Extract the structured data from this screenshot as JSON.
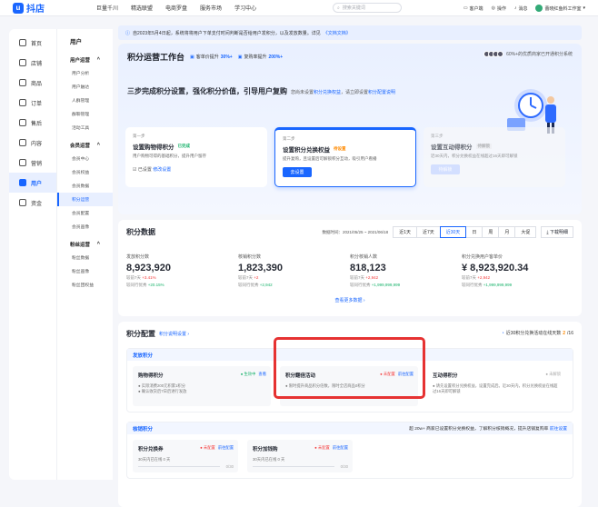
{
  "brand": {
    "name": "抖店"
  },
  "topnav": [
    "巨量千川",
    "精选联盟",
    "电商罗盘",
    "服务市场",
    "学习中心"
  ],
  "search": {
    "placeholder": "搜索关键词"
  },
  "topright": {
    "service": "客户端",
    "help": "操作",
    "msg": "消息",
    "shop": "蕾晓红鱼料工作室"
  },
  "sidebar1": [
    {
      "label": "首页"
    },
    {
      "label": "店铺"
    },
    {
      "label": "商品"
    },
    {
      "label": "订单"
    },
    {
      "label": "售后"
    },
    {
      "label": "内容"
    },
    {
      "label": "营销"
    },
    {
      "label": "用户",
      "active": true
    },
    {
      "label": "资金"
    }
  ],
  "sidebar2": {
    "title": "用户",
    "groups": [
      {
        "label": "用户运营",
        "items": [
          "用户分析",
          "用户触达",
          "人群管理",
          "群聊管理",
          "活动工具"
        ]
      },
      {
        "label": "会员运营",
        "items": [
          "会员中心",
          "会员权益",
          "会员数据",
          "积分运营",
          "会员配置",
          "会员画像"
        ]
      },
      {
        "label": "粉丝运营",
        "items": [
          "粉丝数据",
          "粉丝画像",
          "粉丝团权益"
        ]
      }
    ],
    "active": "积分运营"
  },
  "notice": {
    "text": "自2023年5月4日起，系统将将用户下单支付时间判断是否给用户发积分，以及发放数量。详见",
    "link": "《文档文档》"
  },
  "banner": {
    "title": "积分运营工作台",
    "tag1_label": "客单价提升",
    "tag1_val": "30%+",
    "tag2_label": "复购率提升",
    "tag2_val": "200%+",
    "right": "60%+的优质商家已开通积分系统",
    "subtitle": "三步完成积分设置，强化积分价值，引导用户复购",
    "subdesc": "您尚未设置",
    "sublink": "积分兑换权益",
    "subdesc2": "，请立即设置",
    "sublink2": "积分配置说明"
  },
  "steps": [
    {
      "num": "第一步",
      "title": "设置购物得积分",
      "status": "已完成",
      "desc": "用户购物可得的基础积分，提升用户留存",
      "foot": "已设置",
      "link": "修改设置"
    },
    {
      "num": "第二步",
      "title": "设置积分兑换权益",
      "status": "待设置",
      "desc": "提升复购，且设置后可解锁积分互动，吸引用户看播",
      "btn": "去设置"
    },
    {
      "num": "第三步",
      "title": "设置互动得积分",
      "status": "待解锁",
      "desc": "近30天内，积分兑换权益在线超过16天即可解锁",
      "btn": "待解锁"
    }
  ],
  "data_card": {
    "title": "积分数据",
    "date_range": "数据时间：2021/05/25 ~ 2021/06/18",
    "tabs": [
      "近1天",
      "近7天",
      "近30天",
      "日",
      "周",
      "月",
      "大促"
    ],
    "download": "下载明细",
    "more": "查看更多数据",
    "stats": [
      {
        "label": "发放积分数",
        "value": "8,923,920",
        "cmp1": "较前7天",
        "d1": "+3.41%",
        "cmp2": "较同行优秀",
        "d2": "+20.15%"
      },
      {
        "label": "核销积分数",
        "value": "1,823,390",
        "cmp1": "较前7天",
        "d1": "+2",
        "cmp2": "较同行优秀",
        "d2": "+2,942"
      },
      {
        "label": "积分核销人数",
        "value": "818,123",
        "cmp1": "较前7天",
        "d1": "+2,942",
        "cmp2": "较同行优秀",
        "d2": "+1,999,999,999"
      },
      {
        "label": "积分兑换用户客单价",
        "value": "¥ 8,923,920.34",
        "cmp1": "较前7天",
        "d1": "+2,942",
        "cmp2": "较同行优秀",
        "d2": "+1,999,999,999"
      }
    ]
  },
  "config_card": {
    "title": "积分配置",
    "link": "积分说明设置",
    "right": "近30积分兑换活动在线天数",
    "right_val": "2",
    "right_total": "/16",
    "issue": {
      "title": "发放积分",
      "items": [
        {
          "title": "购物得积分",
          "status": "生效中",
          "action": "查看",
          "desc": "实际消费200元积累1积分",
          "desc2": "确认收货后7日后进行发放"
        },
        {
          "title": "积分翻倍活动",
          "status": "未配置",
          "action": "前往配置",
          "desc": "限时提升商品积分倍数，限时全店商品0积分"
        },
        {
          "title": "互动得积分",
          "status": "未解锁",
          "desc": "请先设置积分兑换权益，设置完成后。近30天内，积分兑换权益在线超过16天即可解锁"
        }
      ]
    },
    "redeem": {
      "title": "核销积分",
      "right": "超 20w+ 商家已设置积分兑换权益，了解积分核销概况，提升店铺复购率",
      "right_link": "前往设置",
      "items": [
        {
          "title": "积分兑换券",
          "status": "未配置",
          "action": "前往配置",
          "desc": "30天内已在线 0 天",
          "frac": "0/30"
        },
        {
          "title": "积分加钱购",
          "status": "未配置",
          "action": "前往配置",
          "desc": "30天内已在线 0 天",
          "frac": "0/30"
        }
      ]
    }
  }
}
